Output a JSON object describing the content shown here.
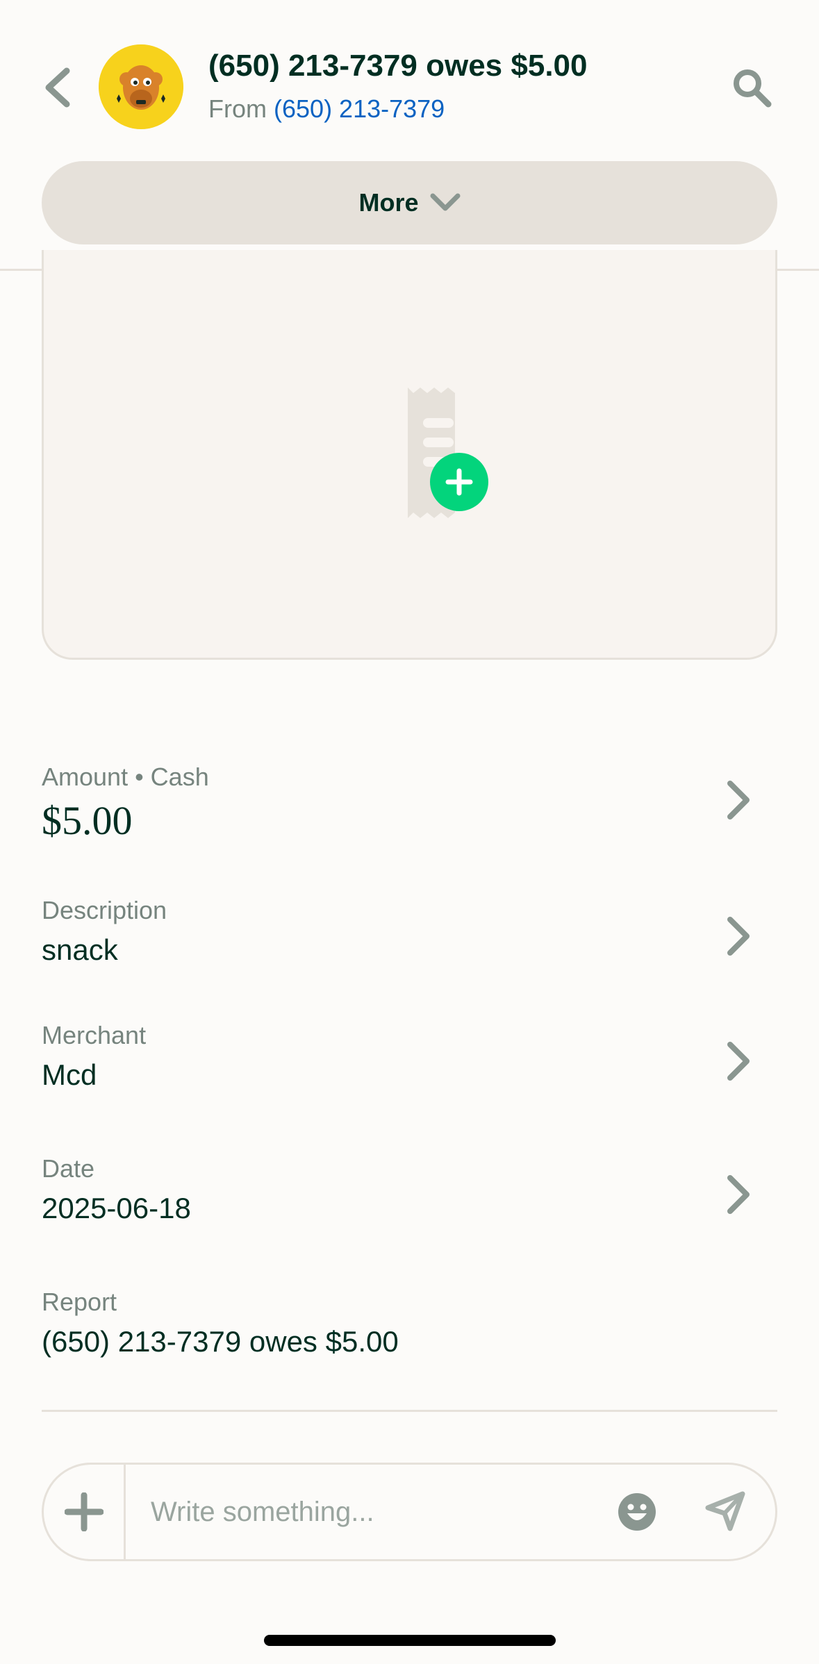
{
  "header": {
    "title": "(650) 213-7379 owes $5.00",
    "from_prefix": "From",
    "from_link": "(650) 213-7379",
    "more_label": "More"
  },
  "icons": {
    "back": "chevron-left-icon",
    "search": "search-icon",
    "more": "chevron-down-icon",
    "receipt": "receipt-add-icon",
    "row": "chevron-right-icon",
    "attach": "plus-icon",
    "emoji": "emoji-icon",
    "send": "send-icon"
  },
  "colors": {
    "accent_green": "#03d47c",
    "link_blue": "#0a62c2",
    "text_dark": "#002e22",
    "text_muted": "#76847e",
    "avatar_yellow": "#f7d21c"
  },
  "details": {
    "amount_label": "Amount • Cash",
    "amount_value": "$5.00",
    "description_label": "Description",
    "description_value": "snack",
    "merchant_label": "Merchant",
    "merchant_value": "Mcd",
    "date_label": "Date",
    "date_value": "2025-06-18",
    "report_label": "Report",
    "report_value": "(650) 213-7379 owes $5.00"
  },
  "composer": {
    "placeholder": "Write something..."
  }
}
